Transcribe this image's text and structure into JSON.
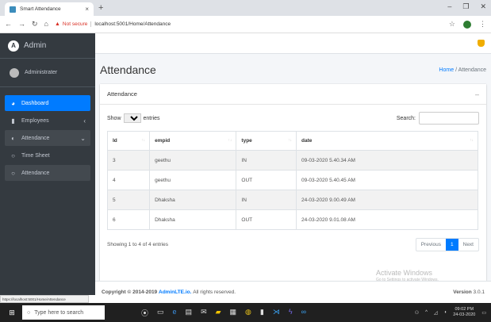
{
  "browser": {
    "tab_title": "Smart Attendance",
    "tab_close": "×",
    "new_tab": "+",
    "not_secure": "Not secure",
    "url": "localhost:5001/Home/Attendance",
    "status_url": "https://localhost:5001/Home/Attendance"
  },
  "sidebar": {
    "brand": "Admin",
    "user_name": "Administrater",
    "items": [
      {
        "label": "Dashboard",
        "icon": "dashboard-icon"
      },
      {
        "label": "Employees",
        "icon": "employees-icon"
      },
      {
        "label": "Attendance",
        "icon": "attendance-icon"
      },
      {
        "label": "Time Sheet",
        "icon": "circle-icon"
      },
      {
        "label": "Attendance",
        "icon": "circle-icon"
      }
    ]
  },
  "header": {
    "title": "Attendance",
    "breadcrumb_home": "Home",
    "breadcrumb_sep": "/",
    "breadcrumb_current": "Attendance"
  },
  "card": {
    "title": "Attendance",
    "show_label": "Show",
    "entries_value": "10",
    "entries_label": "entries",
    "search_label": "Search:",
    "columns": [
      "Id",
      "empid",
      "type",
      "date"
    ],
    "rows": [
      [
        "3",
        "geethu",
        "IN",
        "09-03-2020 5.40.34 AM"
      ],
      [
        "4",
        "geethu",
        "OUT",
        "09-03-2020 5.40.45 AM"
      ],
      [
        "5",
        "Dhaksha",
        "IN",
        "24-03-2020 9.00.49 AM"
      ],
      [
        "6",
        "Dhaksha",
        "OUT",
        "24-03-2020 9.01.08 AM"
      ]
    ],
    "info": "Showing 1 to 4 of 4 entries",
    "prev": "Previous",
    "page": "1",
    "next": "Next"
  },
  "footer": {
    "copyright": "Copyright © 2014-2019",
    "company": "AdminLTE.io.",
    "rights": "All rights reserved.",
    "version_label": "Version",
    "version": "3.0.1"
  },
  "watermark": {
    "title": "Activate Windows",
    "sub": "Go to Settings to activate Windows."
  },
  "taskbar": {
    "search_placeholder": "Type here to search",
    "time": "09:02 PM",
    "date": "24-03-2020"
  }
}
